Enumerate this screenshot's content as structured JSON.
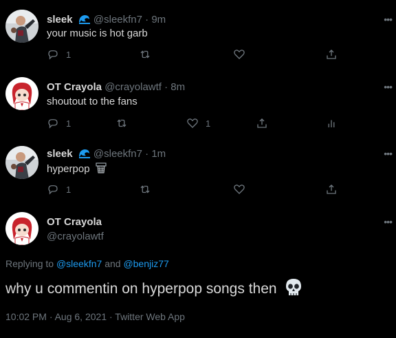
{
  "replies": [
    {
      "name": "sleek",
      "badge_icon": "wave-icon",
      "handle": "@sleekfn7",
      "separator": "·",
      "time": "9m",
      "text": "your music is hot garb",
      "reply_count": "1",
      "retweet_count": "",
      "like_count": "",
      "show_analytics": false
    },
    {
      "name": "OT Crayola",
      "handle": "@crayolawtf",
      "separator": "·",
      "time": "8m",
      "text": "shoutout to the fans",
      "reply_count": "1",
      "retweet_count": "",
      "like_count": "1",
      "show_analytics": true
    },
    {
      "name": "sleek",
      "badge_icon": "wave-icon",
      "handle": "@sleekfn7",
      "separator": "·",
      "time": "1m",
      "text": "hyperpop",
      "text_emoji": "basketball-hoop-icon",
      "reply_count": "1",
      "retweet_count": "",
      "like_count": "",
      "show_analytics": false
    }
  ],
  "main_tweet": {
    "name": "OT Crayola",
    "handle": "@crayolawtf",
    "replying_prefix": "Replying to",
    "replying_user1": "@sleekfn7",
    "replying_and": "and",
    "replying_user2": "@benjiz77",
    "text": "why u commentin on hyperpop songs then",
    "text_emoji": "skull-icon",
    "meta": "10:02 PM · Aug 6, 2021 · Twitter Web App"
  },
  "colors": {
    "background": "#000000",
    "text": "#d9d9d9",
    "muted": "#6e767d",
    "link": "#1d9bf0"
  }
}
